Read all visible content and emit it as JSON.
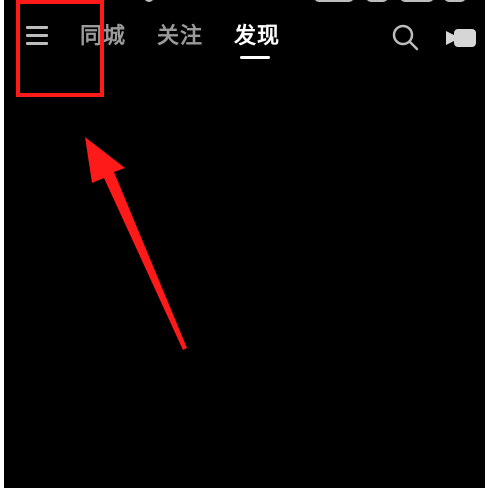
{
  "header": {
    "menu_icon": "hamburger-menu-icon",
    "tabs": [
      {
        "label": "同城",
        "active": false
      },
      {
        "label": "关注",
        "active": false
      },
      {
        "label": "发现",
        "active": true
      }
    ],
    "search_icon": "search-icon",
    "live_icon": "video-camera-icon"
  },
  "annotation": {
    "box_color": "#ff1a1a",
    "arrow_color": "#ff1a1a",
    "target": "menu-button"
  },
  "colors": {
    "background": "#000000",
    "active_tab": "#ffffff",
    "inactive_tab": "#9a9a9a",
    "icon": "#bdbdbd"
  }
}
